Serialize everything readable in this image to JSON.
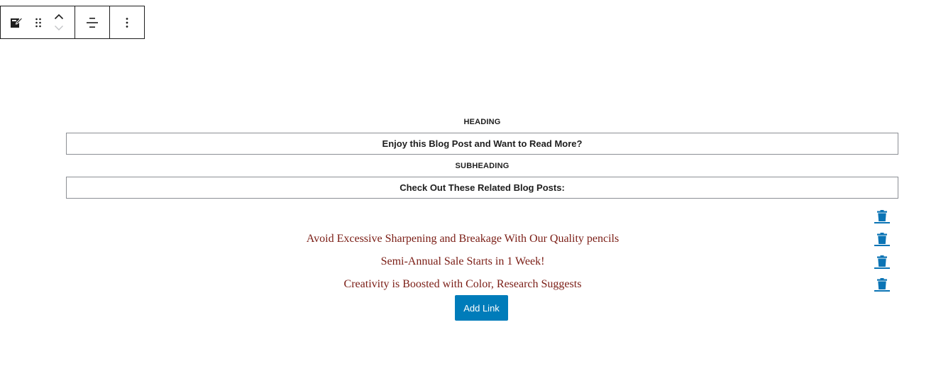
{
  "toolbar": {
    "block_icon": "block-edit-icon",
    "drag_icon": "drag-handle-icon",
    "move_up_icon": "chevron-up-icon",
    "move_down_icon": "chevron-down-icon",
    "align_icon": "align-center-icon",
    "more_icon": "more-options-icon"
  },
  "heading": {
    "label": "HEADING",
    "value": "Enjoy this Blog Post and Want to Read More?"
  },
  "subheading": {
    "label": "SUBHEADING",
    "value": "Check Out These Related Blog Posts:"
  },
  "links": [
    {
      "text": ""
    },
    {
      "text": "Avoid Excessive Sharpening and Breakage With Our Quality pencils"
    },
    {
      "text": "Semi-Annual Sale Starts in 1 Week!"
    },
    {
      "text": "Creativity is Boosted with Color, Research Suggests"
    }
  ],
  "add_link_label": "Add Link",
  "colors": {
    "link_text": "#7a1c14",
    "accent": "#007cba",
    "trash": "#0b74b5"
  }
}
